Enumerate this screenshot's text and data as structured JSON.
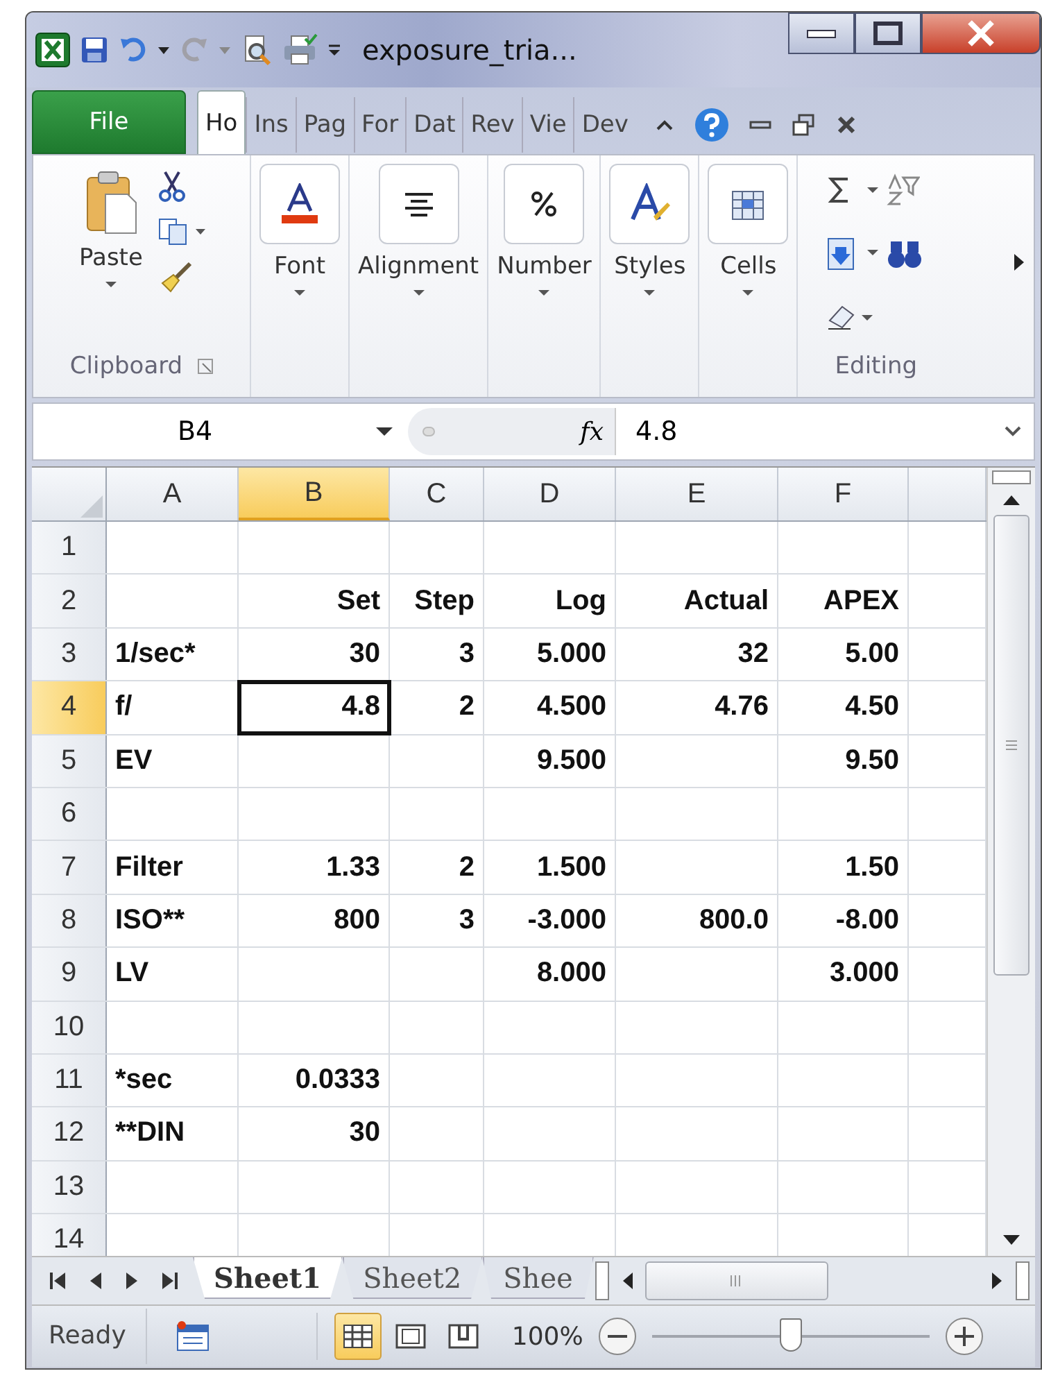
{
  "window": {
    "title": "exposure_tria..."
  },
  "ribbon_tabs": [
    {
      "label": "File",
      "kind": "file",
      "selected": false
    },
    {
      "label": "Ho",
      "kind": "tab",
      "selected": true
    },
    {
      "label": "Ins",
      "kind": "tab",
      "selected": false
    },
    {
      "label": "Pag",
      "kind": "tab",
      "selected": false
    },
    {
      "label": "For",
      "kind": "tab",
      "selected": false
    },
    {
      "label": "Dat",
      "kind": "tab",
      "selected": false
    },
    {
      "label": "Rev",
      "kind": "tab",
      "selected": false
    },
    {
      "label": "Vie",
      "kind": "tab",
      "selected": false
    },
    {
      "label": "Dev",
      "kind": "tab",
      "selected": false
    }
  ],
  "ribbon": {
    "paste_label": "Paste",
    "clipboard_label": "Clipboard",
    "groups": [
      {
        "label": "Font",
        "kind": "font"
      },
      {
        "label": "Alignment",
        "kind": "align"
      },
      {
        "label": "Number",
        "kind": "number"
      },
      {
        "label": "Styles",
        "kind": "styles"
      },
      {
        "label": "Cells",
        "kind": "cells"
      }
    ],
    "editing_label": "Editing"
  },
  "formula_bar": {
    "name_box": "B4",
    "function_button": "fx",
    "value": "4.8"
  },
  "columns": [
    {
      "label": "A",
      "selected": false
    },
    {
      "label": "B",
      "selected": true
    },
    {
      "label": "C",
      "selected": false
    },
    {
      "label": "D",
      "selected": false
    },
    {
      "label": "E",
      "selected": false
    },
    {
      "label": "F",
      "selected": false
    }
  ],
  "rows": [
    {
      "number": "1",
      "selected": false,
      "cells": [
        null,
        null,
        null,
        null,
        null,
        null
      ]
    },
    {
      "number": "2",
      "selected": false,
      "cells": [
        null,
        "Set",
        "Step",
        "Log",
        "Actual",
        "APEX"
      ]
    },
    {
      "number": "3",
      "selected": false,
      "cells": [
        "1/sec*",
        "30",
        "3",
        "5.000",
        "32",
        "5.00"
      ]
    },
    {
      "number": "4",
      "selected": true,
      "cells": [
        "f/",
        "4.8",
        "2",
        "4.500",
        "4.76",
        "4.50"
      ]
    },
    {
      "number": "5",
      "selected": false,
      "cells": [
        "EV",
        null,
        null,
        "9.500",
        null,
        "9.50"
      ]
    },
    {
      "number": "6",
      "selected": false,
      "cells": [
        null,
        null,
        null,
        null,
        null,
        null
      ]
    },
    {
      "number": "7",
      "selected": false,
      "cells": [
        "Filter",
        "1.33",
        "2",
        "1.500",
        null,
        "1.50"
      ]
    },
    {
      "number": "8",
      "selected": false,
      "cells": [
        "ISO**",
        "800",
        "3",
        "-3.000",
        "800.0",
        "-8.00"
      ]
    },
    {
      "number": "9",
      "selected": false,
      "cells": [
        "LV",
        null,
        null,
        "8.000",
        null,
        "3.000"
      ]
    },
    {
      "number": "10",
      "selected": false,
      "cells": [
        null,
        null,
        null,
        null,
        null,
        null
      ]
    },
    {
      "number": "11",
      "selected": false,
      "cells": [
        "*sec",
        "0.0333",
        null,
        null,
        null,
        null
      ]
    },
    {
      "number": "12",
      "selected": false,
      "cells": [
        "**DIN",
        "30",
        null,
        null,
        null,
        null
      ]
    },
    {
      "number": "13",
      "selected": false,
      "cells": [
        null,
        null,
        null,
        null,
        null,
        null
      ]
    },
    {
      "number": "14",
      "selected": false,
      "cells": [
        null,
        null,
        null,
        null,
        null,
        null
      ]
    }
  ],
  "sheet_tabs": [
    {
      "label": "Sheet1",
      "selected": true
    },
    {
      "label": "Sheet2",
      "selected": false
    },
    {
      "label": "Shee",
      "selected": false
    }
  ],
  "status_bar": {
    "status": "Ready",
    "views": [
      {
        "kind": "normal",
        "selected": true
      },
      {
        "kind": "layout",
        "selected": false
      },
      {
        "kind": "break",
        "selected": false
      }
    ],
    "zoom": "100%",
    "zoom_slider": {
      "level": 0.5
    }
  }
}
